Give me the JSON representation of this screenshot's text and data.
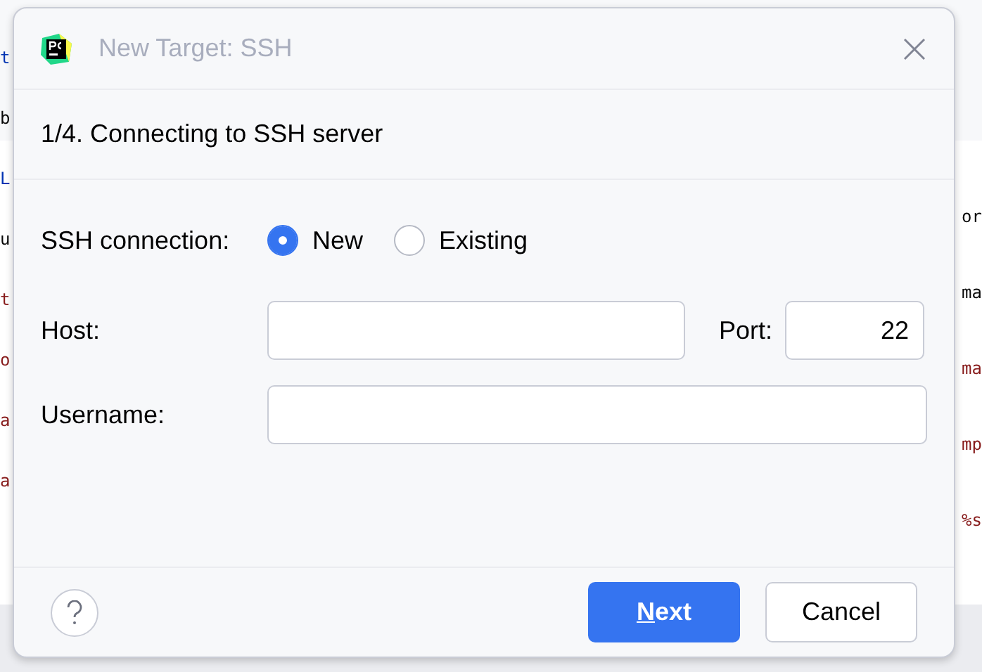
{
  "editor": {
    "left_edge": [
      {
        "text": "t",
        "color": "#0033b3"
      },
      {
        "text": "b",
        "color": "#080808"
      },
      {
        "text": "L",
        "color": "#0033b3"
      },
      {
        "text": "u",
        "color": "#080808"
      },
      {
        "text": "t",
        "color": "#871b1b"
      },
      {
        "text": "o",
        "color": "#871b1b"
      },
      {
        "text": "a",
        "color": "#871b1b"
      },
      {
        "text": "a",
        "color": "#871b1b"
      }
    ],
    "right_edge": [
      {
        "text": "or",
        "color": "#080808"
      },
      {
        "text": "ma",
        "color": "#080808"
      },
      {
        "text": "ma",
        "color": "#871b1b"
      },
      {
        "text": "mp",
        "color": "#871b1b"
      },
      {
        "text": "%s",
        "color": "#871b1b"
      }
    ]
  },
  "dialog": {
    "title": "New Target: SSH",
    "step": "1/4. Connecting to SSH server",
    "connection": {
      "label": "SSH connection:",
      "options": [
        {
          "label": "New",
          "selected": true
        },
        {
          "label": "Existing",
          "selected": false
        }
      ]
    },
    "host": {
      "label": "Host:"
    },
    "port": {
      "label": "Port:",
      "value": "22"
    },
    "username": {
      "label": "Username:"
    },
    "buttons": [
      {
        "label": "Next",
        "kind": "primary",
        "mnemonic_underlined": true
      },
      {
        "label": "Cancel",
        "kind": "secondary",
        "mnemonic_underlined": false
      }
    ]
  }
}
